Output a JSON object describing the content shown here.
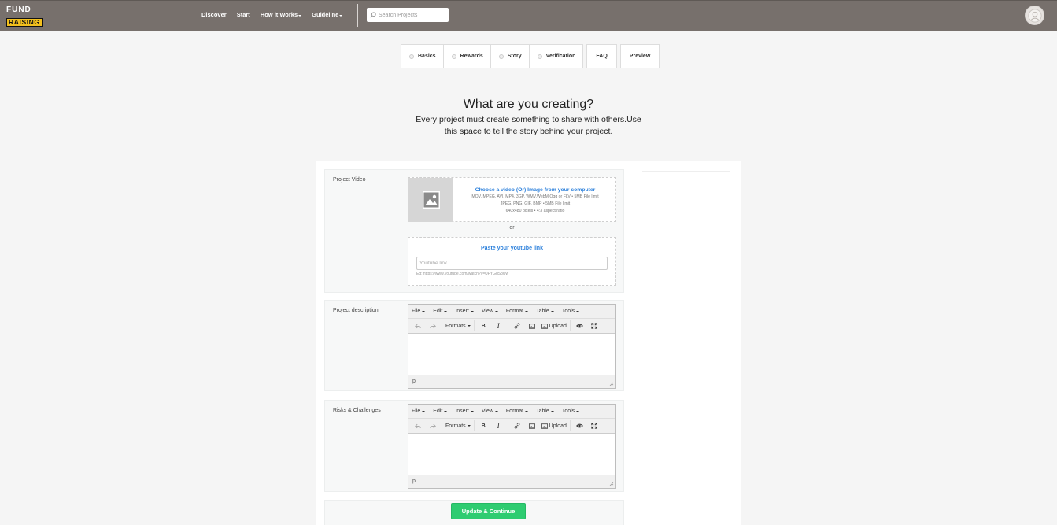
{
  "brand": {
    "line1": "FUND",
    "line2": "RAISING"
  },
  "nav": {
    "discover": "Discover",
    "start": "Start",
    "how_it_works": "How it Works",
    "guideline": "Guideline"
  },
  "search": {
    "placeholder": "Search Projects"
  },
  "steps": {
    "basics": "Basics",
    "rewards": "Rewards",
    "story": "Story",
    "verification": "Verification",
    "faq": "FAQ",
    "preview": "Preview"
  },
  "heading": {
    "title": "What are you creating?",
    "subtitle": "Every project must create something to share with others.Use this space to tell the story behind your project."
  },
  "project_video": {
    "label": "Project Video",
    "upload_title": "Choose a video (Or) Image from your computer",
    "upload_line1": "MOV, MPEG, AVI, MP4, 3GP, WMV,WebM,Ogg or FLV • 5MB File limit",
    "upload_line2": "JPEG, PNG, GIF, BMP • 5MB File limit",
    "upload_line3": "640x480 pixels • 4:3 aspect ratio",
    "or": "or",
    "youtube_title": "Paste your youtube link",
    "youtube_placeholder": "Youtube link",
    "youtube_example": "Eg: https://www.youtube.com/watch?v=UFYGdS8Uw"
  },
  "editor_menu": [
    "File",
    "Edit",
    "Insert",
    "View",
    "Format",
    "Table",
    "Tools"
  ],
  "editor_toolbar": {
    "formats": "Formats",
    "bold": "B",
    "italic": "I",
    "upload": "Upload"
  },
  "description": {
    "label": "Project description",
    "status": "p"
  },
  "risks": {
    "label": "Risks & Challenges",
    "status": "p"
  },
  "actions": {
    "update": "Update & Continue"
  },
  "colors": {
    "header_bg": "#77706c",
    "link_blue": "#2a7fdb",
    "button_green": "#2ecc71"
  }
}
